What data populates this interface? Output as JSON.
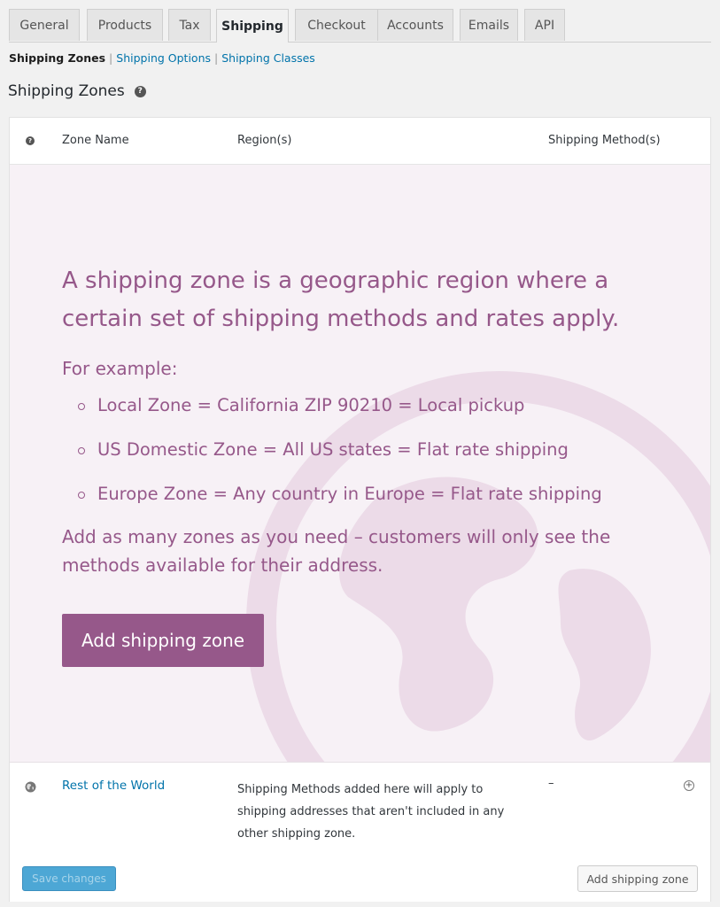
{
  "tabs": [
    {
      "label": "General"
    },
    {
      "label": "Products"
    },
    {
      "label": "Tax"
    },
    {
      "label": "Shipping",
      "active": true
    },
    {
      "label": "Checkout"
    },
    {
      "label": "Accounts"
    },
    {
      "label": "Emails"
    },
    {
      "label": "API"
    }
  ],
  "subnav": {
    "current": "Shipping Zones",
    "separator": "|",
    "links": [
      "Shipping Options",
      "Shipping Classes"
    ]
  },
  "page_title": "Shipping Zones",
  "help_icon": "question-circle-icon",
  "table": {
    "columns": [
      "Zone Name",
      "Region(s)",
      "Shipping Method(s)"
    ],
    "blank_state": {
      "lead": "A shipping zone is a geographic region where a certain set of shipping methods and rates apply.",
      "for_example": "For example:",
      "examples": [
        "Local Zone = California ZIP 90210 = Local pickup",
        "US Domestic Zone = All US states = Flat rate shipping",
        "Europe Zone = Any country in Europe = Flat rate shipping"
      ],
      "note": "Add as many zones as you need – customers will only see the methods available for their address.",
      "button": "Add shipping zone"
    },
    "rest_of_world": {
      "name": "Rest of the World",
      "region": "Shipping Methods added here will apply to shipping addresses that aren't included in any other shipping zone.",
      "methods": "–",
      "icon": "globe-icon"
    }
  },
  "footer": {
    "save": "Save changes",
    "add": "Add shipping zone"
  },
  "colors": {
    "accent": "#96588a",
    "blank_bg": "#f7f1f6",
    "link": "#0073aa",
    "save_btn": "#4da7d5"
  }
}
